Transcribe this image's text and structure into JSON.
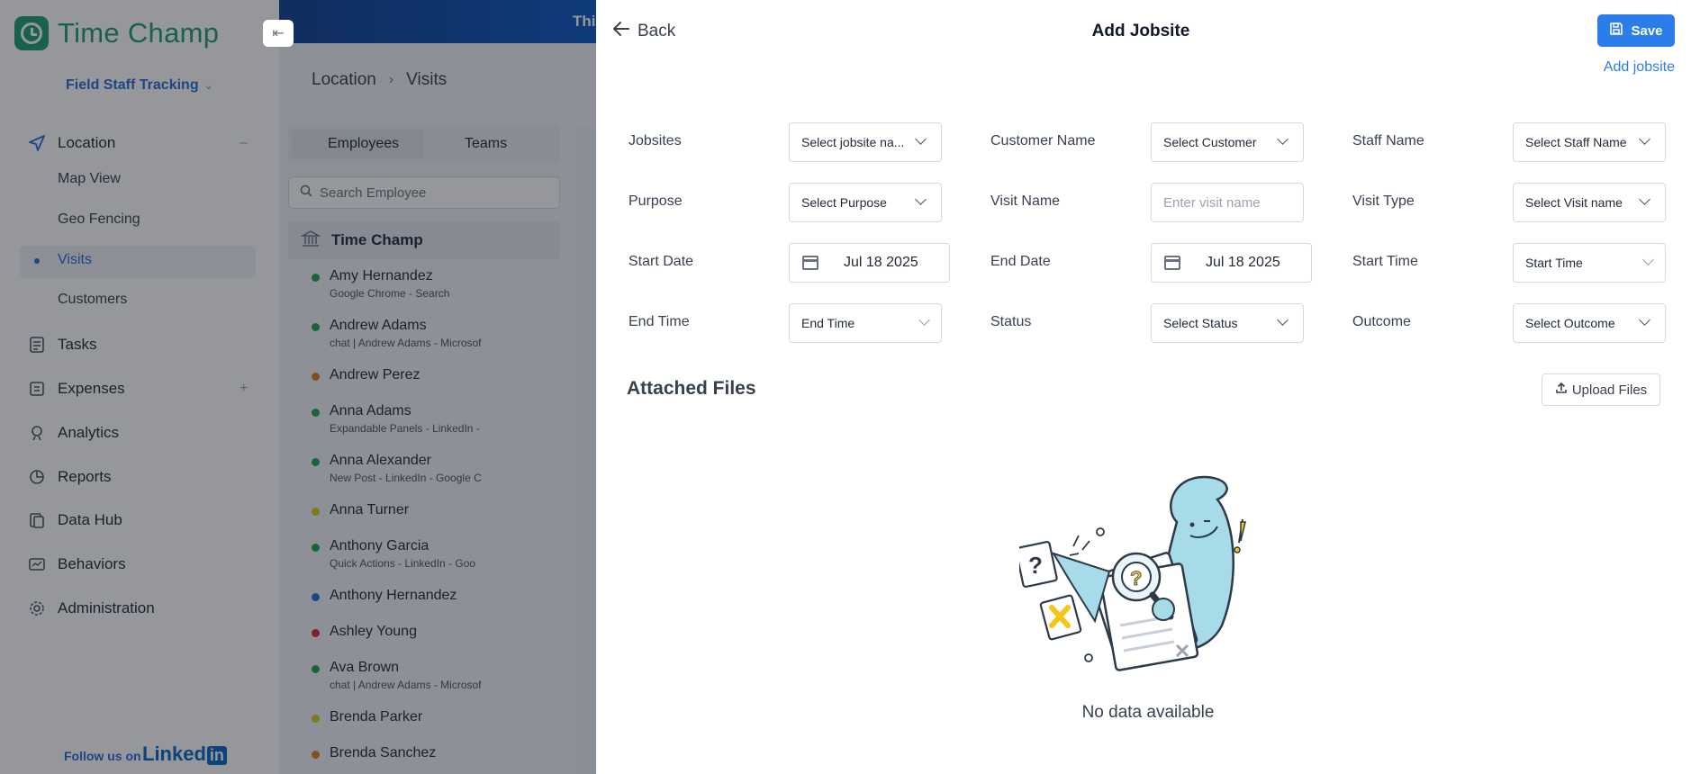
{
  "app": {
    "name": "Time Champ",
    "collapse_icon": "collapse-left-icon"
  },
  "workspace": {
    "selector": "Field Staff Tracking"
  },
  "nav": {
    "location": "Location",
    "map_view": "Map View",
    "geo_fencing": "Geo Fencing",
    "visits": "Visits",
    "customers": "Customers",
    "tasks": "Tasks",
    "expenses": "Expenses",
    "analytics": "Analytics",
    "reports": "Reports",
    "data_hub": "Data Hub",
    "behaviors": "Behaviors",
    "administration": "Administration"
  },
  "footer": {
    "follow": "Follow us on",
    "linkedin_a": "Linked",
    "linkedin_b": "in"
  },
  "banner": {
    "text": "This"
  },
  "breadcrumb": {
    "root": "Location",
    "current": "Visits"
  },
  "tabs": {
    "employees": "Employees",
    "teams": "Teams"
  },
  "search": {
    "placeholder": "Search Employee"
  },
  "org": {
    "name": "Time Champ"
  },
  "employees": [
    {
      "name": "Amy Hernandez",
      "sub": "Google Chrome - Search",
      "color": "#22a34a"
    },
    {
      "name": "Andrew Adams",
      "sub": "chat | Andrew Adams - Microsof",
      "color": "#22a34a"
    },
    {
      "name": "Andrew Perez",
      "sub": "",
      "color": "#e07a1f"
    },
    {
      "name": "Anna Adams",
      "sub": "Expandable Panels - LinkedIn - ",
      "color": "#22a34a"
    },
    {
      "name": "Anna Alexander",
      "sub": "New Post - LinkedIn - Google C",
      "color": "#22a34a"
    },
    {
      "name": "Anna Turner",
      "sub": "",
      "color": "#d6c81a"
    },
    {
      "name": "Anthony Garcia",
      "sub": "Quick Actions - LinkedIn - Goo",
      "color": "#22a34a"
    },
    {
      "name": "Anthony Hernandez",
      "sub": "",
      "color": "#2b6ad8"
    },
    {
      "name": "Ashley Young",
      "sub": "",
      "color": "#d62828"
    },
    {
      "name": "Ava Brown",
      "sub": "chat | Andrew Adams - Microsof",
      "color": "#22a34a"
    },
    {
      "name": "Brenda Parker",
      "sub": "",
      "color": "#d6c81a"
    },
    {
      "name": "Brenda Sanchez",
      "sub": "",
      "color": "#e07a1f"
    }
  ],
  "drawer": {
    "back": "Back",
    "title": "Add Jobsite",
    "save": "Save",
    "add_jobsite": "Add jobsite",
    "fields": {
      "jobsites": {
        "label": "Jobsites",
        "value": "Select jobsite na..."
      },
      "customer_name": {
        "label": "Customer Name",
        "value": "Select Customer"
      },
      "staff_name": {
        "label": "Staff Name",
        "value": "Select Staff Name"
      },
      "purpose": {
        "label": "Purpose",
        "value": "Select Purpose"
      },
      "visit_name": {
        "label": "Visit Name",
        "placeholder": "Enter visit name"
      },
      "visit_type": {
        "label": "Visit Type",
        "value": "Select Visit name"
      },
      "start_date": {
        "label": "Start Date",
        "value": "Jul 18 2025"
      },
      "end_date": {
        "label": "End Date",
        "value": "Jul 18 2025"
      },
      "start_time": {
        "label": "Start Time",
        "value": "Start Time"
      },
      "end_time": {
        "label": "End Time",
        "value": "End Time"
      },
      "status": {
        "label": "Status",
        "value": "Select Status"
      },
      "outcome": {
        "label": "Outcome",
        "value": "Select Outcome"
      }
    },
    "attached_files": "Attached Files",
    "upload_files": "Upload Files",
    "empty_state": "No data available"
  }
}
